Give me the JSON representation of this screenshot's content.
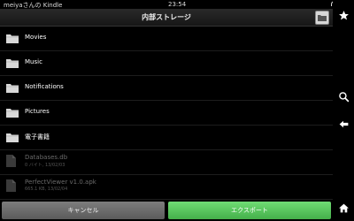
{
  "status_bar": {
    "left_text": "meiyaさんの Kindle",
    "time": "23:54"
  },
  "header": {
    "title": "内部ストレージ"
  },
  "list": {
    "items": [
      {
        "name": "Movies",
        "type": "folder",
        "icon": "folder-icon"
      },
      {
        "name": "Music",
        "type": "folder",
        "icon": "folder-icon"
      },
      {
        "name": "Notifications",
        "type": "folder",
        "icon": "folder-icon"
      },
      {
        "name": "Pictures",
        "type": "folder",
        "icon": "folder-icon"
      },
      {
        "name": "電子書籍",
        "type": "folder",
        "icon": "folder-icon"
      },
      {
        "name": "Databases.db",
        "meta": "0 バイト, 13/02/03",
        "type": "file",
        "icon": "file-icon"
      },
      {
        "name": "PerfectViewer v1.0.apk",
        "meta": "665.1 KB, 13/02/04",
        "type": "file",
        "icon": "file-icon"
      }
    ]
  },
  "footer": {
    "cancel_label": "キャンセル",
    "export_label": "エクスポート"
  },
  "colors": {
    "export_green": "#45b04a",
    "cancel_gray": "#6b6b6b",
    "header_bg": "#1f1f1f"
  },
  "side_nav": {
    "icons": [
      "star-icon",
      "search-icon",
      "back-arrow-icon",
      "home-icon"
    ]
  }
}
